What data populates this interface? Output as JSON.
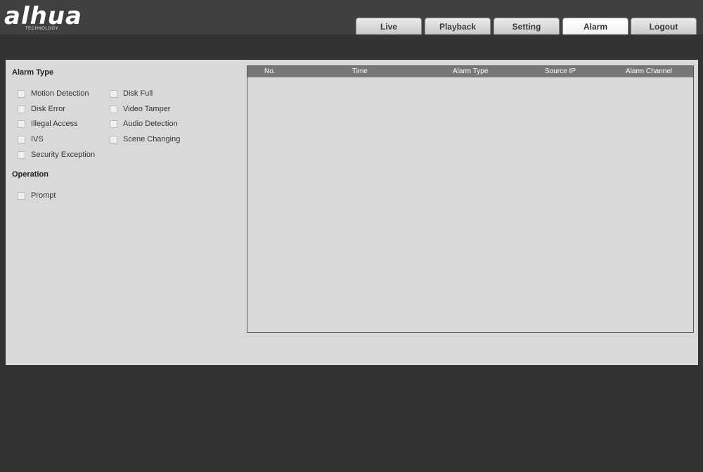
{
  "brand": {
    "logo_text": "alhua",
    "logo_sub": "TECHNOLOGY"
  },
  "nav": {
    "tabs": [
      {
        "label": "Live"
      },
      {
        "label": "Playback"
      },
      {
        "label": "Setting"
      },
      {
        "label": "Alarm",
        "active": true
      },
      {
        "label": "Logout"
      }
    ]
  },
  "alarm_type": {
    "title": "Alarm Type",
    "options": [
      {
        "label": "Motion Detection",
        "checked": false
      },
      {
        "label": "Disk Full",
        "checked": false
      },
      {
        "label": "Disk Error",
        "checked": false
      },
      {
        "label": "Video Tamper",
        "checked": false
      },
      {
        "label": "Illegal Access",
        "checked": false
      },
      {
        "label": "Audio Detection",
        "checked": false
      },
      {
        "label": "IVS",
        "checked": false
      },
      {
        "label": "Scene Changing",
        "checked": false
      },
      {
        "label": "Security Exception",
        "checked": false
      }
    ]
  },
  "operation": {
    "title": "Operation",
    "options": [
      {
        "label": "Prompt",
        "checked": false
      }
    ]
  },
  "alarm_table": {
    "columns": [
      "No.",
      "Time",
      "Alarm Type",
      "Source IP",
      "Alarm Channel"
    ],
    "rows": []
  },
  "colors": {
    "background": "#333333",
    "header": "#404040",
    "panel": "#d9d9d9",
    "table_header": "#777777"
  }
}
